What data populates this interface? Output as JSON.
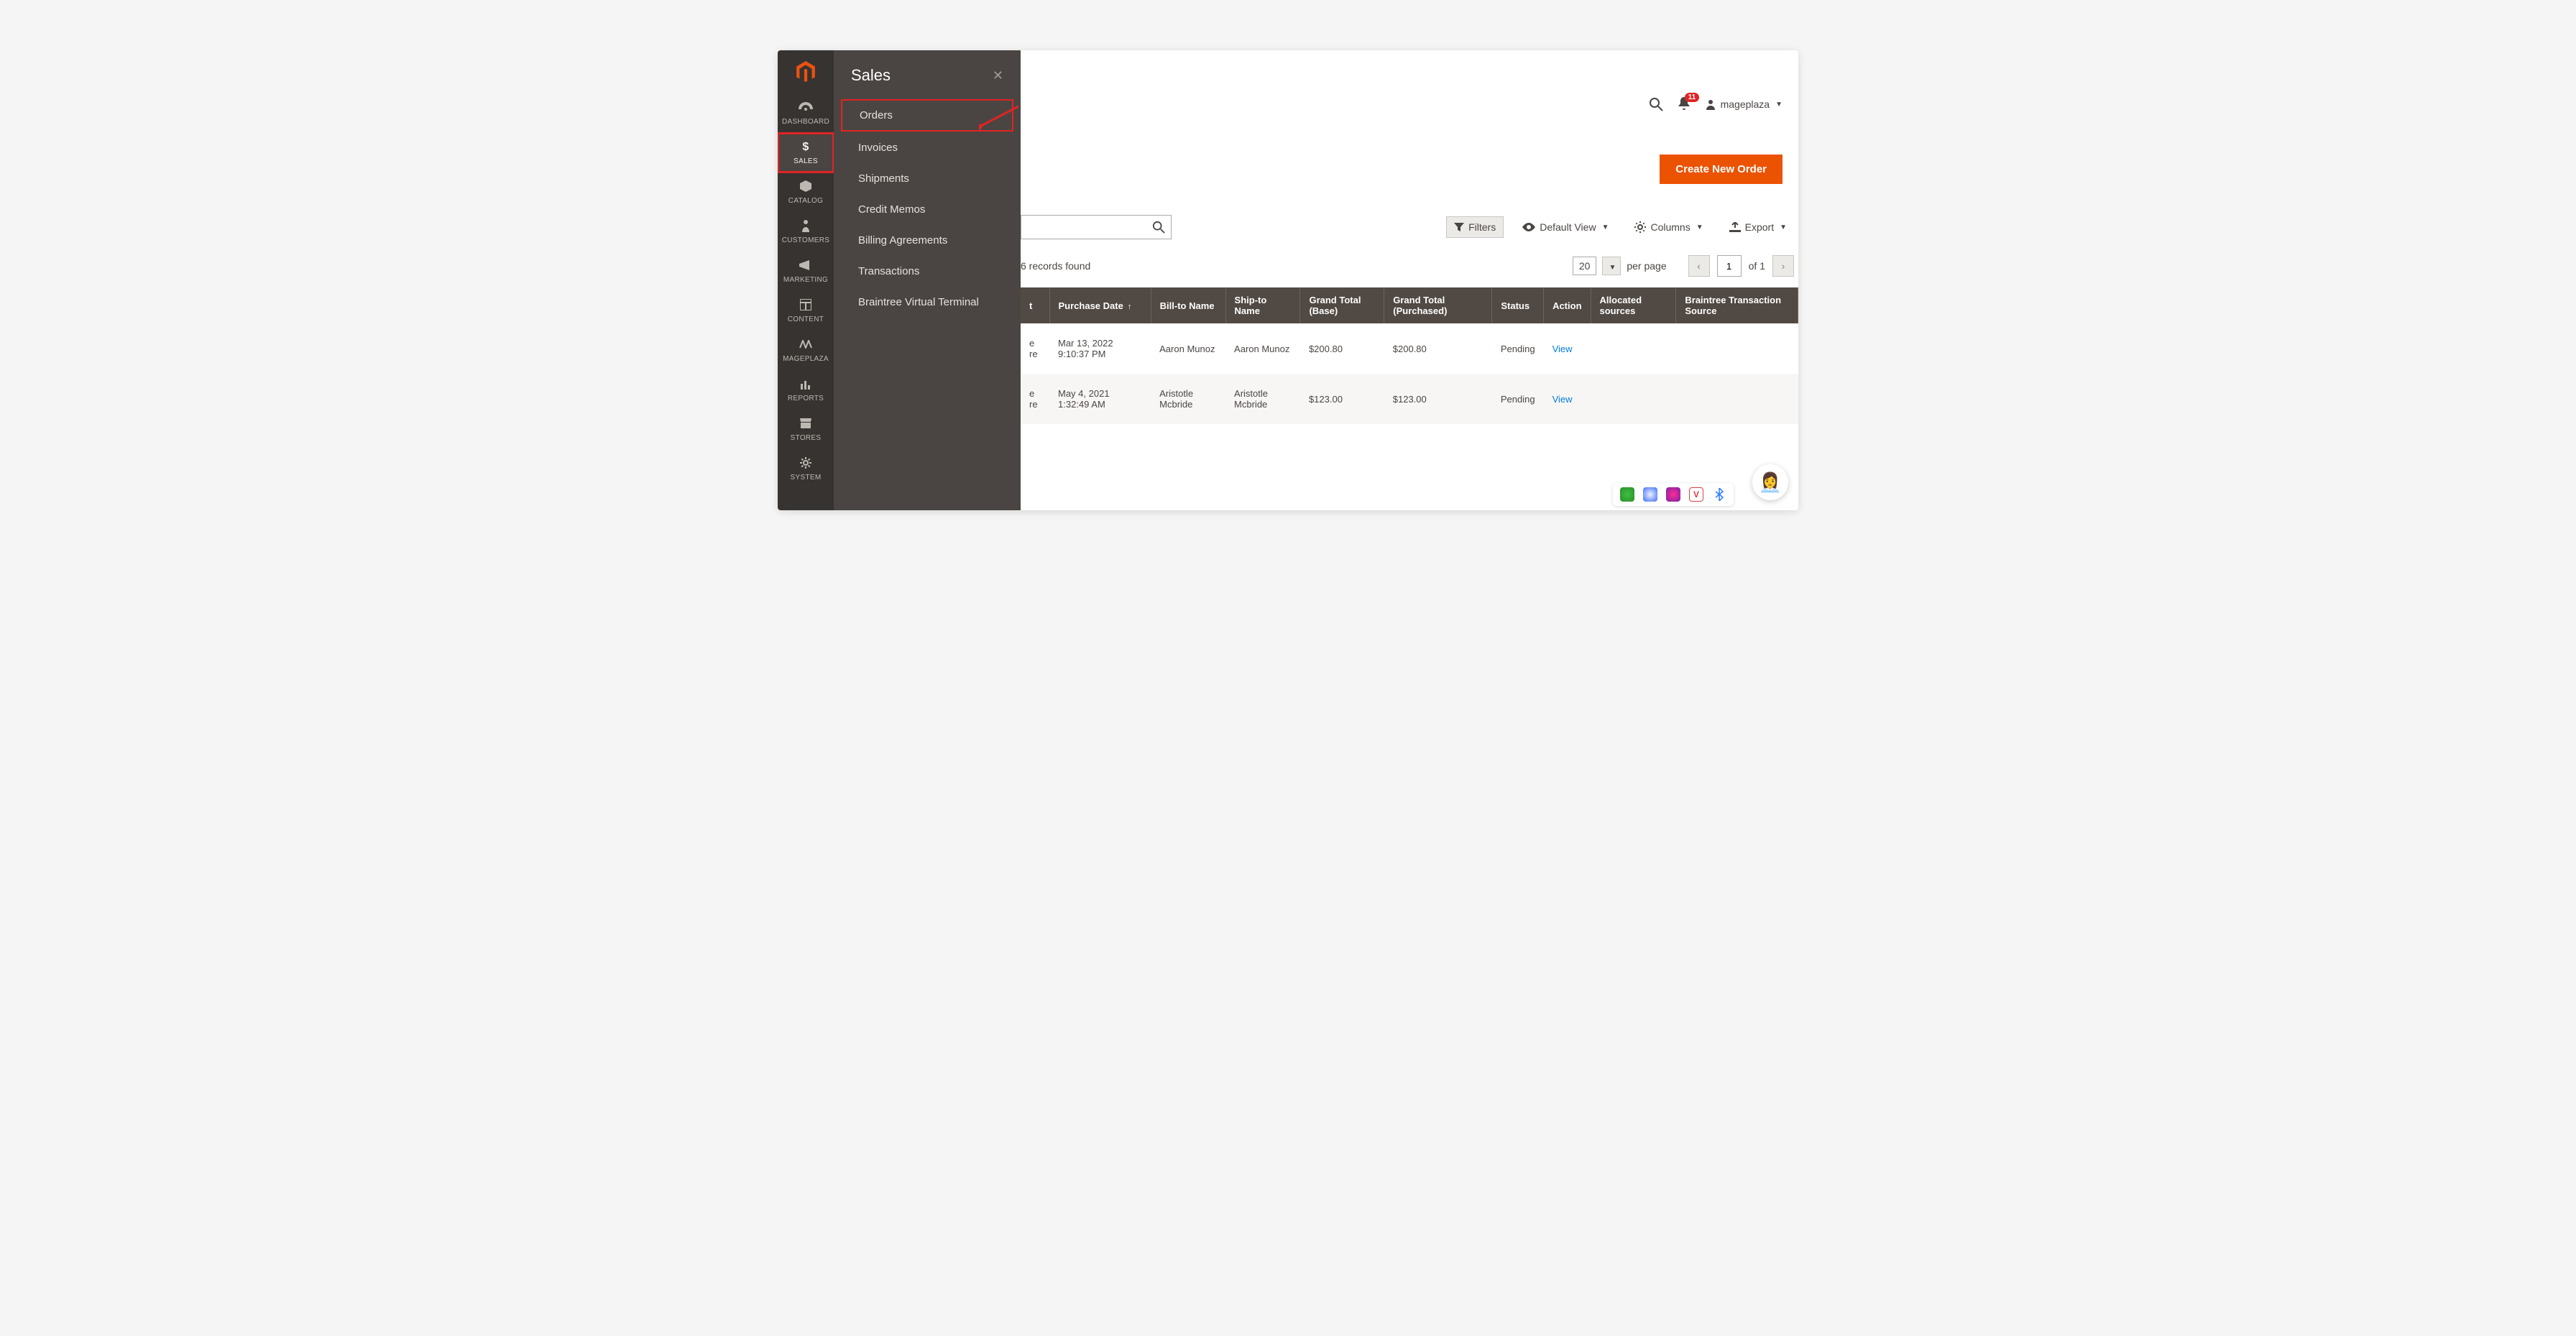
{
  "flyout": {
    "title": "Sales",
    "items": [
      {
        "label": "Orders",
        "highlighted": true
      },
      {
        "label": "Invoices"
      },
      {
        "label": "Shipments"
      },
      {
        "label": "Credit Memos"
      },
      {
        "label": "Billing Agreements"
      },
      {
        "label": "Transactions"
      },
      {
        "label": "Braintree Virtual Terminal"
      }
    ]
  },
  "nav": {
    "items": [
      {
        "label": "DASHBOARD"
      },
      {
        "label": "SALES",
        "active": true,
        "highlighted": true
      },
      {
        "label": "CATALOG"
      },
      {
        "label": "CUSTOMERS"
      },
      {
        "label": "MARKETING"
      },
      {
        "label": "CONTENT"
      },
      {
        "label": "MAGEPLAZA"
      },
      {
        "label": "REPORTS"
      },
      {
        "label": "STORES"
      },
      {
        "label": "SYSTEM"
      }
    ]
  },
  "header": {
    "notifications_count": "11",
    "username": "mageplaza"
  },
  "actions": {
    "create_order_label": "Create New Order"
  },
  "toolbar": {
    "filters_label": "Filters",
    "default_view_label": "Default View",
    "columns_label": "Columns",
    "export_label": "Export"
  },
  "pager": {
    "records_found_label": "6 records found",
    "page_size": "20",
    "per_page_label": "per page",
    "current_page": "1",
    "of_label": "of 1"
  },
  "grid": {
    "columns": [
      "Purchase Date",
      "Bill-to Name",
      "Ship-to Name",
      "Grand Total (Base)",
      "Grand Total (Purchased)",
      "Status",
      "Action",
      "Allocated sources",
      "Braintree Transaction Source"
    ],
    "rows": [
      {
        "purchase_date": "Mar 13, 2022 9:10:37 PM",
        "bill_to": "Aaron Munoz",
        "ship_to": "Aaron Munoz",
        "grand_total_base": "$200.80",
        "grand_total_purchased": "$200.80",
        "status": "Pending",
        "action": "View",
        "allocated_sources": "",
        "braintree_source": ""
      },
      {
        "purchase_date": "May 4, 2021 1:32:49 AM",
        "bill_to": "Aristotle Mcbride",
        "ship_to": "Aristotle Mcbride",
        "grand_total_base": "$123.00",
        "grand_total_purchased": "$123.00",
        "status": "Pending",
        "action": "View",
        "allocated_sources": "",
        "braintree_source": ""
      }
    ]
  }
}
